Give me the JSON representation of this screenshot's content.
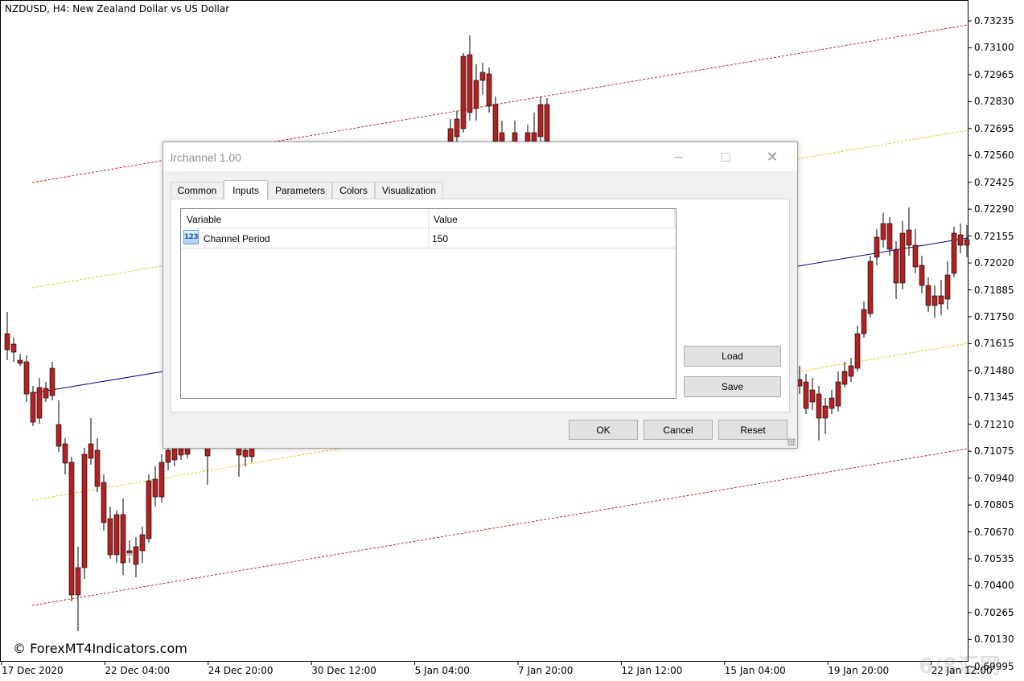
{
  "chart": {
    "title": "NZDUSD, H4:  New Zealand Dollar vs US Dollar",
    "watermark": "© ForexMT4Indicators.com",
    "corner_mark": "6/8汇网",
    "price_axis": [
      "0.73235",
      "0.73100",
      "0.72965",
      "0.72830",
      "0.72695",
      "0.72560",
      "0.72425",
      "0.72290",
      "0.72155",
      "0.72020",
      "0.71885",
      "0.71750",
      "0.71615",
      "0.71480",
      "0.71345",
      "0.71210",
      "0.71075",
      "0.70940",
      "0.70805",
      "0.70670",
      "0.70535",
      "0.70400",
      "0.70265",
      "0.70130",
      "0.69995"
    ],
    "time_axis": [
      "17 Dec 2020",
      "22 Dec 04:00",
      "24 Dec 20:00",
      "30 Dec 12:00",
      "5 Jan 04:00",
      "7 Jan 20:00",
      "12 Jan 12:00",
      "15 Jan 04:00",
      "19 Jan 20:00",
      "22 Jan 12:00"
    ],
    "colors": {
      "bull": "#3cb371",
      "bear": "#b22222",
      "wick": "#000000",
      "regression": "#00008b",
      "outer_channel": "#cc2222",
      "inner_channel": "#f0c419"
    }
  },
  "dialog": {
    "title": "lrchannel 1.00",
    "tabs": [
      "Common",
      "Inputs",
      "Parameters",
      "Colors",
      "Visualization"
    ],
    "active_tab": "Inputs",
    "table": {
      "headers": [
        "Variable",
        "Value"
      ],
      "rows": [
        {
          "icon": "123",
          "variable": "Channel Period",
          "value": "150"
        }
      ]
    },
    "buttons": {
      "load": "Load",
      "save": "Save",
      "ok": "OK",
      "cancel": "Cancel",
      "reset": "Reset"
    }
  }
}
